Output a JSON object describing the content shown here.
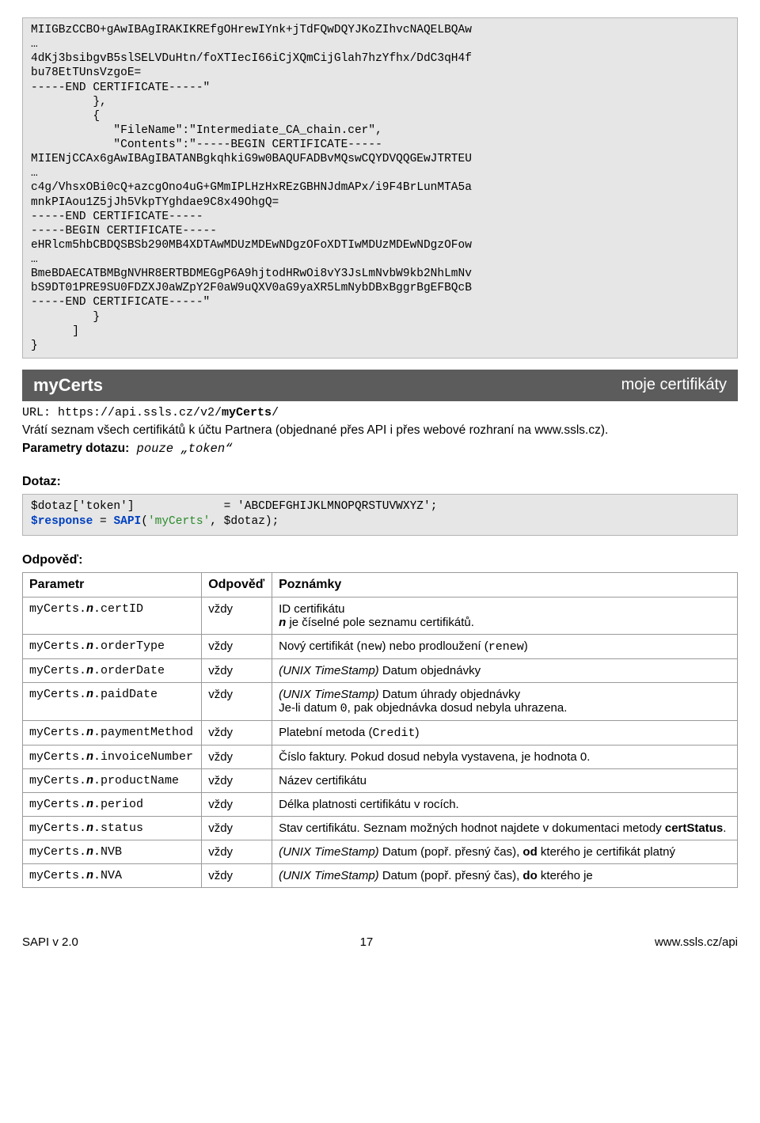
{
  "code_block": "MIIGBzCCBO+gAwIBAgIRAKIKREfgOHrewIYnk+jTdFQwDQYJKoZIhvcNAQELBQAw\n…\n4dKj3bsibgvB5slSELVDuHtn/foXTIecI66iCjXQmCijGlah7hzYfhx/DdC3qH4f\nbu78EtTUnsVzgoE=\n-----END CERTIFICATE-----\"\n         },\n         {\n            \"FileName\":\"Intermediate_CA_chain.cer\",\n            \"Contents\":\"-----BEGIN CERTIFICATE-----\nMIIENjCCAx6gAwIBAgIBATANBgkqhkiG9w0BAQUFADBvMQswCQYDVQQGEwJTRTEU\n…\nc4g/VhsxOBi0cQ+azcgOno4uG+GMmIPLHzHxREzGBHNJdmAPx/i9F4BrLunMTA5a\nmnkPIAou1Z5jJh5VkpTYghdae9C8x49OhgQ=\n-----END CERTIFICATE-----\n-----BEGIN CERTIFICATE-----\neHRlcm5hbCBDQSBSb290MB4XDTAwMDUzMDEwNDgzOFoXDTIwMDUzMDEwNDgzOFow\n…\nBmeBDAECATBMBgNVHR8ERTBDMEGgP6A9hjtodHRwOi8vY3JsLmNvbW9kb2NhLmNv\nbS9DT01PRE9SU0FDZXJ0aWZpY2F0aW9uQXV0aG9yaXR5LmNybDBxBggrBgEFBQcB\n-----END CERTIFICATE-----\"\n         }\n      ]\n}",
  "section": {
    "left": "myCerts",
    "right": "moje certifikáty"
  },
  "url_prefix": "URL: https://api.ssls.cz/v2/",
  "url_bold": "myCerts",
  "url_suffix": "/",
  "desc_line1": "Vrátí seznam všech certifikátů k účtu Partnera (objednané přes API i přes webové rozhraní na www.ssls.cz).",
  "params_label": "Parametry dotazu:",
  "params_value_prefix": " pouze „",
  "params_value_code": "token",
  "params_value_suffix": "“",
  "heading_query": "Dotaz:",
  "query_line1_left": "$dotaz['token']",
  "query_line1_mid": "             = 'ABCDEFGHIJKLMNOPQRSTUVWXYZ';",
  "query_line2_v1": "$response",
  "query_line2_v2": " = ",
  "query_line2_v3": "SAPI",
  "query_line2_v4": "(",
  "query_line2_v5": "'myCerts'",
  "query_line2_v6": ", $dotaz);",
  "heading_response": "Odpověď:",
  "thead": {
    "c1": "Parametr",
    "c2": "Odpověď",
    "c3": "Poznámky"
  },
  "vzdy": "vždy",
  "rows": {
    "r0": {
      "p_pre": "myCerts.",
      "p_bi": "n",
      "p_post": ".certID",
      "n1": "ID certifikátu",
      "n2_bi": "n",
      "n2_rest": " je číselné pole seznamu certifikátů."
    },
    "r1": {
      "p_pre": "myCerts.",
      "p_bi": "n",
      "p_post": ".orderType",
      "n_a": "Nový certifikát (",
      "n_b": "new",
      "n_c": ") nebo prodloužení (",
      "n_d": "renew",
      "n_e": ")"
    },
    "r2": {
      "p_pre": "myCerts.",
      "p_bi": "n",
      "p_post": ".orderDate",
      "n_i": "(UNIX TimeStamp)",
      "n_rest": " Datum objednávky"
    },
    "r3": {
      "p_pre": "myCerts.",
      "p_bi": "n",
      "p_post": ".paidDate",
      "n_i": "(UNIX TimeStamp)",
      "n_rest": " Datum úhrady objednávky",
      "n2_a": "Je-li datum ",
      "n2_b": "0",
      "n2_c": ", pak objednávka dosud nebyla uhrazena."
    },
    "r4": {
      "p_pre": "myCerts.",
      "p_bi": "n",
      "p_post": ".paymentMethod",
      "n_a": "Platební metoda (",
      "n_b": "Credit",
      "n_c": ")"
    },
    "r5": {
      "p_pre": "myCerts.",
      "p_bi": "n",
      "p_post": ".invoiceNumber",
      "n": "Číslo faktury. Pokud dosud nebyla vystavena, je hodnota 0."
    },
    "r6": {
      "p_pre": "myCerts.",
      "p_bi": "n",
      "p_post": ".productName",
      "n": "Název certifikátu"
    },
    "r7": {
      "p_pre": "myCerts.",
      "p_bi": "n",
      "p_post": ".period",
      "n": "Délka platnosti certifikátu v rocích."
    },
    "r8": {
      "p_pre": "myCerts.",
      "p_bi": "n",
      "p_post": ".status",
      "n_a": "Stav certifikátu. Seznam možných hodnot najdete v dokumentaci metody ",
      "n_b": "certStatus",
      "n_c": "."
    },
    "r9": {
      "p_pre": "myCerts.",
      "p_bi": "n",
      "p_post": ".NVB",
      "n_i": "(UNIX TimeStamp)",
      "n_a": " Datum (popř. přesný čas), ",
      "n_b": "od",
      "n_c": " kterého je certifikát platný"
    },
    "r10": {
      "p_pre": "myCerts.",
      "p_bi": "n",
      "p_post": ".NVA",
      "n_i": "(UNIX TimeStamp)",
      "n_a": " Datum (popř. přesný čas), ",
      "n_b": "do",
      "n_c": " kterého je"
    }
  },
  "footer": {
    "left": "SAPI v 2.0",
    "center": "17",
    "right": "www.ssls.cz/api"
  }
}
